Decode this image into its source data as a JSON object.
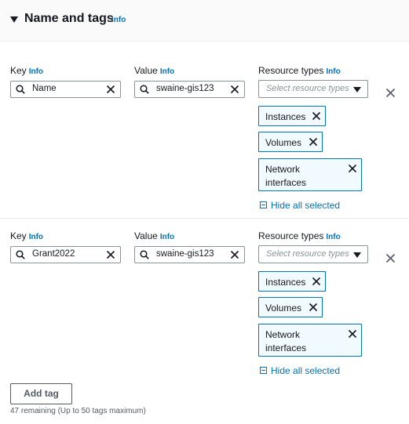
{
  "section": {
    "title": "Name and tags",
    "info": "Info"
  },
  "labels": {
    "key": "Key",
    "value": "Value",
    "resource_types": "Resource types",
    "info": "Info"
  },
  "tags": [
    {
      "key": "Name",
      "value": "swaine-gis123",
      "resource_placeholder": "Select resource types",
      "tokens": [
        "Instances",
        "Volumes",
        "Network interfaces"
      ],
      "hide_label": "Hide all selected"
    },
    {
      "key": "Grant2022",
      "value": "swaine-gis123",
      "resource_placeholder": "Select resource types",
      "tokens": [
        "Instances",
        "Volumes",
        "Network interfaces"
      ],
      "hide_label": "Hide all selected"
    }
  ],
  "add_tag_label": "Add tag",
  "remaining_text": "47 remaining (Up to 50 tags maximum)",
  "colors": {
    "link": "#0073bb",
    "border": "#879596",
    "text": "#16191f"
  }
}
